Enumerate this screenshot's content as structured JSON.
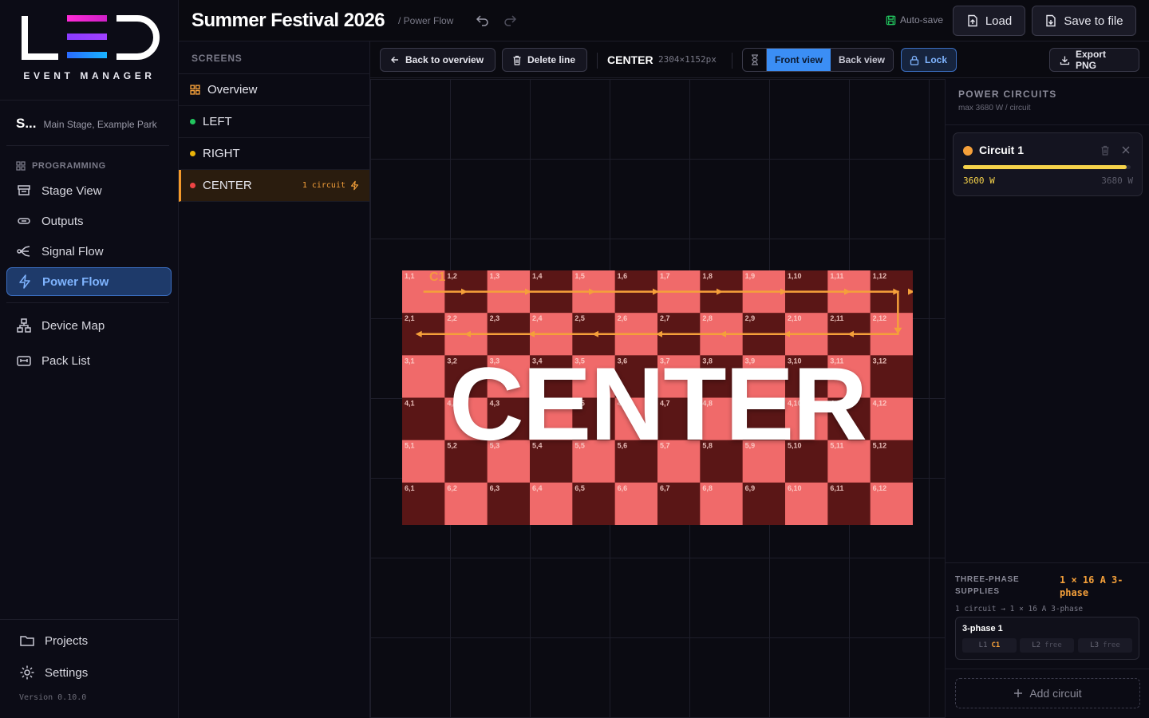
{
  "logo": {
    "subtitle": "EVENT MANAGER"
  },
  "project": {
    "name": "S...",
    "location": "Main Stage, Example Park"
  },
  "sidebar": {
    "section_label": "PROGRAMMING",
    "items": [
      {
        "label": "Stage View",
        "icon": "stage-icon"
      },
      {
        "label": "Outputs",
        "icon": "outputs-icon"
      },
      {
        "label": "Signal Flow",
        "icon": "signal-flow-icon"
      },
      {
        "label": "Power Flow",
        "icon": "power-icon",
        "active": true
      },
      {
        "label": "Device Map",
        "icon": "device-map-icon"
      },
      {
        "label": "Pack List",
        "icon": "pack-list-icon"
      }
    ],
    "bottom": [
      {
        "label": "Projects",
        "icon": "folder-icon"
      },
      {
        "label": "Settings",
        "icon": "gear-icon"
      }
    ],
    "version": "Version 0.10.0"
  },
  "header": {
    "title": "Summer Festival 2026",
    "subtitle": "/ Power Flow",
    "autosave_label": "Auto-save",
    "load_label": "Load",
    "save_label": "Save to file"
  },
  "screens": {
    "label": "SCREENS",
    "items": [
      {
        "label": "Overview",
        "icon": "grid-icon"
      },
      {
        "label": "LEFT",
        "dot_color": "#22c55e"
      },
      {
        "label": "RIGHT",
        "dot_color": "#eab308"
      },
      {
        "label": "CENTER",
        "dot_color": "#ef4444",
        "badge": "1 circuit",
        "active": true
      }
    ]
  },
  "toolbar": {
    "back_label": "Back to overview",
    "delete_label": "Delete line",
    "screen_name": "CENTER",
    "screen_dims": "2304×1152px",
    "front_view_label": "Front view",
    "back_view_label": "Back view",
    "lock_label": "Lock",
    "export_label": "Export PNG"
  },
  "canvas": {
    "screen_text": "CENTER",
    "circuit_tag": "C1",
    "rows": 6,
    "cols": 12,
    "tile_light": "#f06a6a",
    "tile_dark": "#5a1616",
    "line_color": "#f5a03a"
  },
  "power": {
    "title": "POWER CIRCUITS",
    "subtitle": "max 3680 W / circuit",
    "circuits": [
      {
        "name": "Circuit 1",
        "watts": "3600 W",
        "max": "3680 W",
        "load_fraction": 0.978,
        "color": "#f5a03a"
      }
    ],
    "phase_label": "THREE-PHASE SUPPLIES",
    "phase_value": "1 × 16 A 3-phase",
    "phase_note": "1 circuit → 1 × 16 A 3-phase",
    "supply": {
      "name": "3-phase 1",
      "lines": [
        {
          "line": "L1",
          "value": "C1"
        },
        {
          "line": "L2",
          "value": "free"
        },
        {
          "line": "L3",
          "value": "free"
        }
      ]
    },
    "add_label": "Add circuit"
  }
}
